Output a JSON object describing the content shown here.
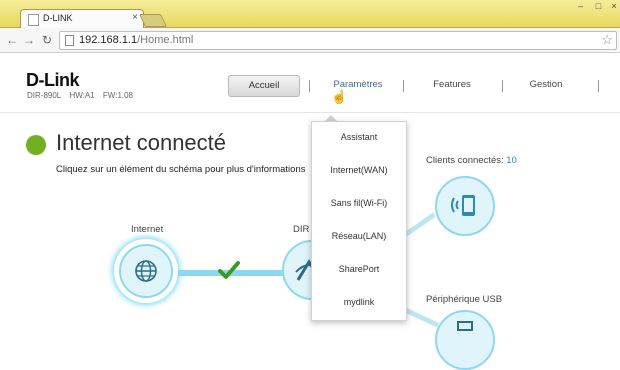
{
  "browser": {
    "tab_title": "D-LINK",
    "tab_close": "×",
    "url_host": "192.168.1.1",
    "url_path": "/Home.html",
    "window_controls": [
      "–",
      "□",
      "×"
    ],
    "icons": {
      "back": "back-arrow-icon",
      "forward": "forward-arrow-icon",
      "reload": "reload-icon",
      "star": "star-icon"
    }
  },
  "header": {
    "logo": "D-Link",
    "model": "DIR-890L",
    "hw": "HW:A1",
    "fw": "FW:1.08"
  },
  "nav": {
    "accueil": "Accueil",
    "parametres": "Paramètres",
    "features": "Features",
    "gestion": "Gestion"
  },
  "status": {
    "title": "Internet connecté",
    "hint": "Cliquez sur un élément du schéma pour plus d'informations",
    "color": "#6fb11f"
  },
  "diagram": {
    "internet_label": "Internet",
    "router_label": "DIR",
    "clients_label": "Clients connectés:",
    "clients_count": "10",
    "usb_label": "Périphérique USB",
    "accent": "#8fd7ee"
  },
  "dropdown": {
    "items": [
      "Assistant",
      "Internet(WAN)",
      "Sans fil(Wi-Fi)",
      "Réseau(LAN)",
      "SharePort",
      "mydlink"
    ]
  }
}
